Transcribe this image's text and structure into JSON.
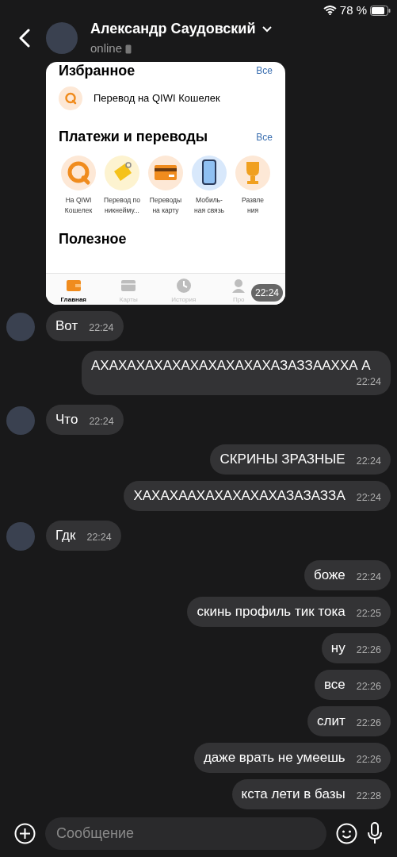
{
  "status_bar": {
    "battery": "78 %"
  },
  "header": {
    "title": "Александр Саудовский",
    "subtitle": "online"
  },
  "messages": [
    {
      "kind": "image_in",
      "avatar": false,
      "time": "22:24",
      "app": {
        "favorites": {
          "title": "Избранное",
          "link": "Все",
          "item": "Перевод на QIWI Кошелек"
        },
        "payments": {
          "title": "Платежи и переводы",
          "link": "Все",
          "tiles": [
            {
              "kind": "qiwi",
              "label": "На QIWI\nКошелек"
            },
            {
              "kind": "tag",
              "label": "Перевод по\nникнейму..."
            },
            {
              "kind": "card",
              "label": "Переводы\nна карту"
            },
            {
              "kind": "phone",
              "label": "Мобиль-\nная связь"
            },
            {
              "kind": "trophy",
              "label": "Развле\nния"
            }
          ]
        },
        "useful": {
          "title": "Полезное"
        },
        "tabs": [
          {
            "kind": "wallet",
            "label": "Главная",
            "selected": true
          },
          {
            "kind": "cards",
            "label": "Карты",
            "selected": false
          },
          {
            "kind": "history",
            "label": "История",
            "selected": false
          },
          {
            "kind": "profile",
            "label": "Про",
            "selected": false
          }
        ]
      }
    },
    {
      "kind": "text_in",
      "avatar": true,
      "text": "Вот",
      "time": "22:24"
    },
    {
      "kind": "text_out",
      "avatar": false,
      "text": "АХАХАХАХАХАХАХАХАХАХАЗАЗЗААХХА А",
      "time": "22:24"
    },
    {
      "kind": "text_in",
      "avatar": true,
      "text": "Что",
      "time": "22:24"
    },
    {
      "kind": "text_out",
      "avatar": false,
      "text": "СКРИНЫ ЗРАЗНЫЕ",
      "time": "22:24"
    },
    {
      "kind": "text_out",
      "avatar": false,
      "text": "ХАХАХААХАХАХАХАХАЗАЗАЗЗА",
      "time": "22:24"
    },
    {
      "kind": "text_in",
      "avatar": true,
      "text": "Гдк",
      "time": "22:24"
    },
    {
      "kind": "text_out",
      "avatar": false,
      "text": "боже",
      "time": "22:24"
    },
    {
      "kind": "text_out",
      "avatar": false,
      "text": "скинь профиль тик тока",
      "time": "22:25"
    },
    {
      "kind": "text_out",
      "avatar": false,
      "text": "ну",
      "time": "22:26"
    },
    {
      "kind": "text_out",
      "avatar": false,
      "text": "все",
      "time": "22:26"
    },
    {
      "kind": "text_out",
      "avatar": false,
      "text": "слит",
      "time": "22:26"
    },
    {
      "kind": "text_out",
      "avatar": false,
      "text": "даже врать не умеешь",
      "time": "22:26"
    },
    {
      "kind": "text_out",
      "avatar": false,
      "text": "кста лети в базы",
      "time": "22:28"
    }
  ],
  "composer": {
    "placeholder": "Сообщение"
  }
}
